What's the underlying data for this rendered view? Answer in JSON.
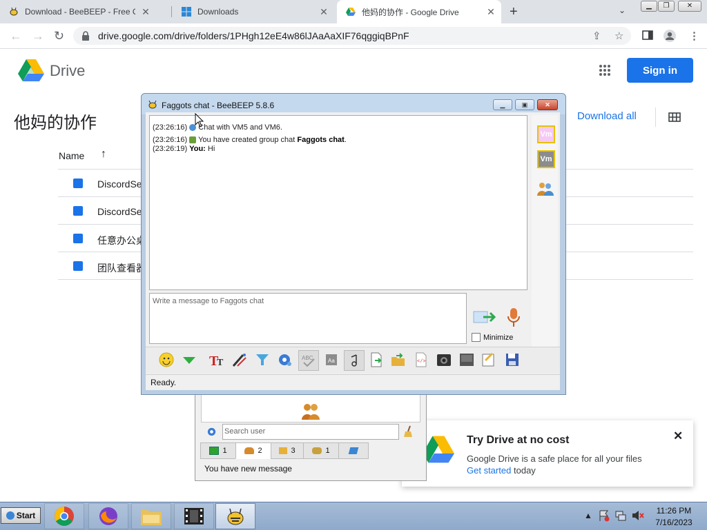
{
  "browser": {
    "tabs": [
      {
        "label": "Download - BeeBEEP - Free Offic",
        "active": false
      },
      {
        "label": "Downloads",
        "active": false
      },
      {
        "label": "他妈的协作 - Google Drive",
        "active": true
      }
    ],
    "new_tab": "+",
    "url": "drive.google.com/drive/folders/1PHgh12eE4w86lJAaAaXIF76qggiqBPnF"
  },
  "drive": {
    "brand": "Drive",
    "sign_in": "Sign in",
    "folder_title": "他妈的协作",
    "download_all": "Download all",
    "name_column": "Name",
    "files": [
      {
        "name": "DiscordSe"
      },
      {
        "name": "DiscordSe"
      },
      {
        "name": "任意办公桌"
      },
      {
        "name": "团队查看器"
      }
    ],
    "promo": {
      "title": "Try Drive at no cost",
      "text": "Google Drive is a safe place for all your files",
      "link": "Get started",
      "suffix": "today"
    }
  },
  "beebeep_main": {
    "search_placeholder": "Search user",
    "tabs": [
      "1",
      "2",
      "3",
      "1",
      ""
    ],
    "status": "You have new message"
  },
  "chat": {
    "title": "Faggots chat - BeeBEEP 5.8.6",
    "log": [
      {
        "time": "(23:26:16)",
        "text": "Chat with VM5 and VM6."
      },
      {
        "time": "(23:26:16)",
        "text": "You have created group chat ",
        "bold": "Faggots chat",
        "after": "."
      },
      {
        "time": "(23:26:19)",
        "sender": "You:",
        "text": " Hi"
      }
    ],
    "placeholder": "Write a message to Faggots chat",
    "minimize_label": "Minimize",
    "avatars": [
      "Vm",
      "Vm"
    ],
    "status": "Ready."
  },
  "taskbar": {
    "start": "Start",
    "time": "11:26 PM",
    "date": "7/16/2023"
  },
  "colors": {
    "google_blue": "#1a73e8",
    "chrome_tabstrip": "#dee1e6",
    "beebeep_frame": "#c5d9ee"
  }
}
